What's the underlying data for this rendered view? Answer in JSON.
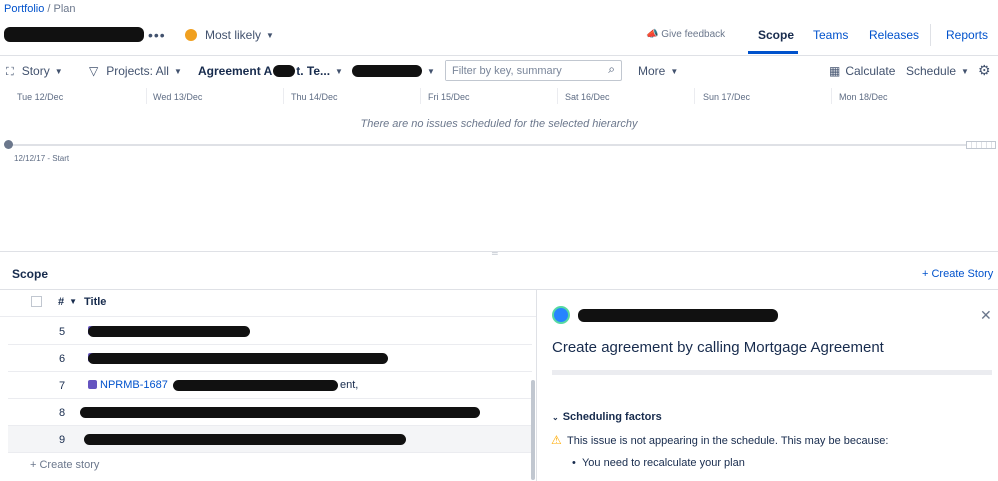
{
  "breadcrumb": {
    "portfolio": "Portfolio",
    "separator": " / ",
    "plan": "Plan"
  },
  "header": {
    "more": "•••",
    "scenario": "Most likely",
    "feedback": "Give feedback",
    "tabs": [
      {
        "label": "Scope",
        "active": true
      },
      {
        "label": "Teams"
      },
      {
        "label": "Releases"
      },
      {
        "label": "Reports"
      }
    ]
  },
  "toolbar": {
    "hierarchy": "Story",
    "projects": "Projects: All",
    "team_filter": "Agreement A",
    "team_filter_tail": "t. Te...",
    "search_placeholder": "Filter by key, summary",
    "more": "More",
    "calculate": "Calculate",
    "schedule": "Schedule"
  },
  "timeline": {
    "days": [
      "Tue 12/Dec",
      "Wed 13/Dec",
      "Thu 14/Dec",
      "Fri 15/Dec",
      "Sat 16/Dec",
      "Sun 17/Dec",
      "Mon 18/Dec"
    ],
    "empty_message": "There are no issues scheduled for the selected hierarchy",
    "start_label": "12/12/17 - Start"
  },
  "scope": {
    "title": "Scope",
    "create_story": "+ Create Story",
    "columns": {
      "num": "#",
      "title": "Title"
    },
    "rows": [
      {
        "num": "5",
        "text": ""
      },
      {
        "num": "6",
        "text": ""
      },
      {
        "num": "7",
        "key": "NPRMB-1687",
        "text": "ent,"
      },
      {
        "num": "8",
        "text": ""
      },
      {
        "num": "9",
        "text": ""
      }
    ],
    "create_story_bottom": "+ Create story"
  },
  "detail": {
    "title": "Create agreement by calling Mortgage Agreement",
    "section": "Scheduling factors",
    "warning": "This issue is not appearing in the schedule. This may be because:",
    "reasons": [
      "You need to recalculate your plan"
    ]
  },
  "colors": {
    "accent": "#0052cc",
    "scenario_dot": "#f0a020",
    "issue_type": "#6554c0",
    "warning": "#ffab00"
  }
}
